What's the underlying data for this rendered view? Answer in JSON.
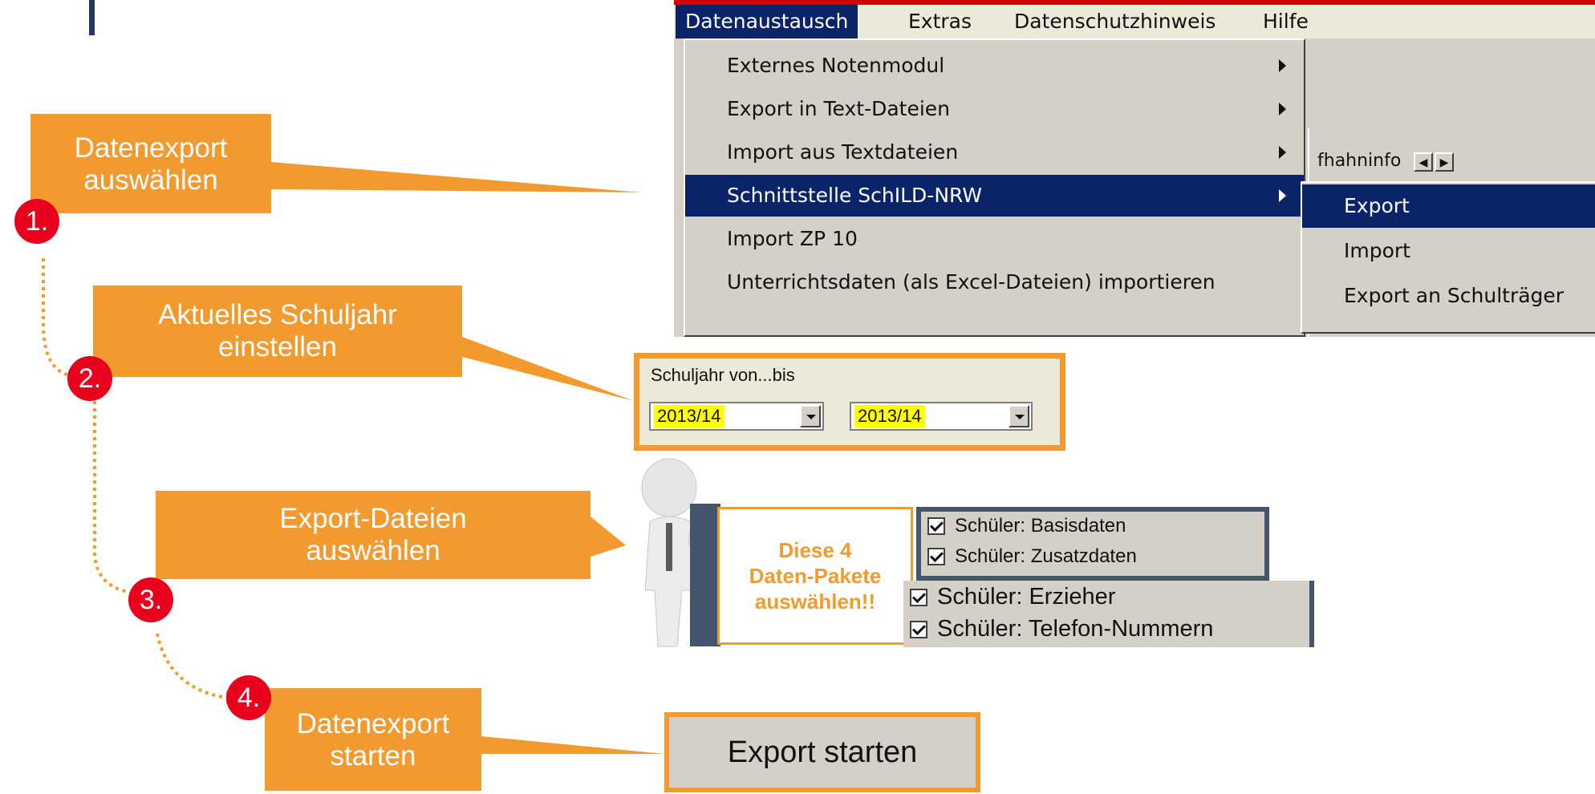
{
  "callouts": {
    "step1": {
      "line1": "Datenexport",
      "line2": "auswählen",
      "number": "1."
    },
    "step2": {
      "line1": "Aktuelles Schuljahr",
      "line2": "einstellen",
      "number": "2."
    },
    "step3": {
      "line1": "Export-Dateien",
      "line2": "auswählen",
      "number": "3."
    },
    "step4": {
      "line1": "Datenexport",
      "line2": "starten",
      "number": "4."
    }
  },
  "menubar": {
    "items": [
      "Datenaustausch",
      "Extras",
      "Datenschutzhinweis",
      "Hilfe"
    ],
    "active": "Datenaustausch"
  },
  "dropdown": {
    "items": [
      "Externes Notenmodul",
      "Export in Text-Dateien",
      "Import aus Textdateien",
      "Schnittstelle SchILD-NRW",
      "Import ZP 10",
      "Unterrichtsdaten (als Excel-Dateien) importieren"
    ],
    "highlighted": "Schnittstelle SchILD-NRW"
  },
  "submenu": {
    "items": [
      "Export",
      "Import",
      "Export an Schulträger"
    ],
    "highlighted": "Export"
  },
  "background_tab": {
    "fragment": "fhahninfo"
  },
  "schuljahr": {
    "label": "Schuljahr von...bis",
    "from": "2013/14",
    "to": "2013/14"
  },
  "note": {
    "text_line1": "Diese 4",
    "text_line2": "Daten-Pakete",
    "text_line3": "auswählen!!"
  },
  "checkboxes": [
    {
      "label": "Schüler: Basisdaten",
      "checked": true
    },
    {
      "label": "Schüler: Zusatzdaten",
      "checked": true
    },
    {
      "label": "Schüler: Erzieher",
      "checked": true
    },
    {
      "label": "Schüler: Telefon-Nummern",
      "checked": true
    }
  ],
  "export_button": {
    "label": "Export starten"
  },
  "colors": {
    "accent": "#f39a2e",
    "badge": "#e8001c",
    "menu_highlight": "#0a246a",
    "frame": "#44546a"
  }
}
